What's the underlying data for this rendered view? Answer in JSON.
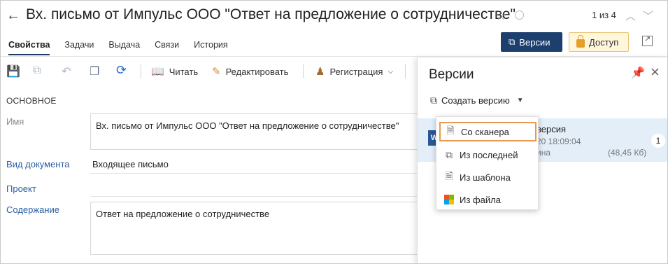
{
  "header": {
    "title": "Вх. письмо от Импульс ООО \"Ответ на предложение о сотрудничестве\"",
    "pager": "1 из 4"
  },
  "tabs": [
    {
      "label": "Свойства",
      "active": true
    },
    {
      "label": "Задачи"
    },
    {
      "label": "Выдача"
    },
    {
      "label": "Связи"
    },
    {
      "label": "История"
    }
  ],
  "actions": {
    "versions_label": "Версии",
    "access_label": "Доступ"
  },
  "toolbar": {
    "read_label": "Читать",
    "edit_label": "Редактировать",
    "register_label": "Регистрация"
  },
  "form": {
    "section": "ОСНОВНОЕ",
    "name_label": "Имя",
    "name_value": "Вх. письмо от Импульс ООО \"Ответ на предложение о сотрудничестве\"",
    "doctype_label": "Вид документа",
    "doctype_value": "Входящее письмо",
    "project_label": "Проект",
    "content_label": "Содержание",
    "content_value": "Ответ на предложение о сотрудничестве"
  },
  "versions_panel": {
    "title": "Версии",
    "create_label": "Создать версию",
    "version": {
      "name": "версия",
      "date": "20 18:09:04",
      "author": "ина",
      "size": "(48,45 Кб)",
      "number": "1"
    }
  },
  "create_menu": {
    "items": [
      {
        "label": "Со сканера",
        "icon": "scanner-doc-icon",
        "selected": true
      },
      {
        "label": "Из последней",
        "icon": "copy-last-icon"
      },
      {
        "label": "Из шаблона",
        "icon": "template-icon"
      },
      {
        "label": "Из файла",
        "icon": "windows-logo-icon"
      }
    ]
  },
  "colors": {
    "primary": "#1d3f6e",
    "link": "#2a5fa0",
    "highlight": "#e3eef9",
    "selection_border": "#e59a50",
    "access_bg": "#fff6dc"
  }
}
